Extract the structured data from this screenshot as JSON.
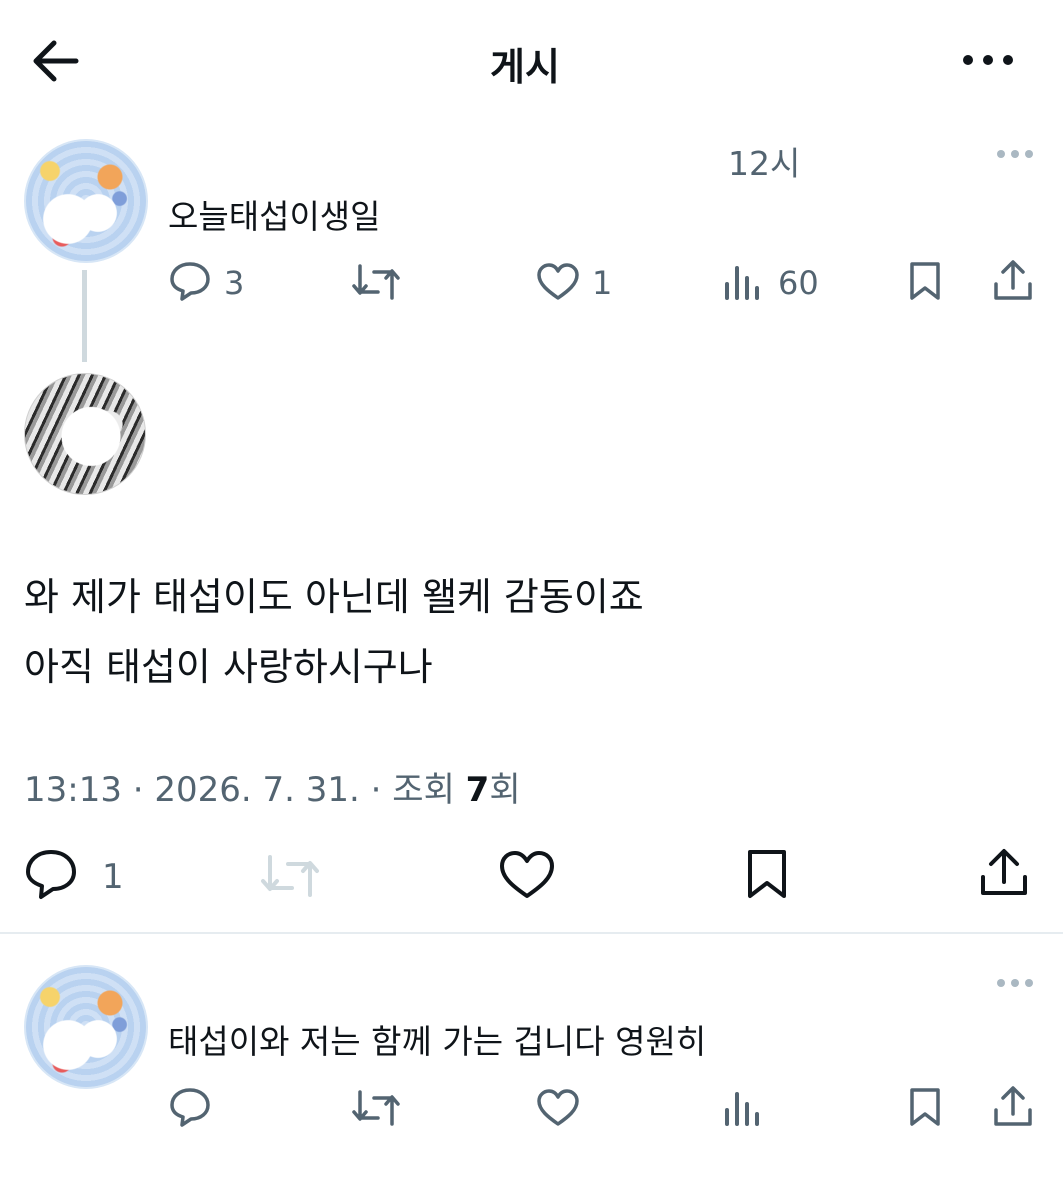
{
  "header": {
    "title": "게시"
  },
  "parent_post": {
    "time": "12시",
    "text": "오늘태섭이생일",
    "replies": "3",
    "likes": "1",
    "views": "60"
  },
  "main_post": {
    "line1": "와 제가 태섭이도 아닌데 왤케 감동이죠",
    "line2": "아직 태섭이 사랑하시구나",
    "meta_prefix": "13:13 · 2026. 7. 31. · 조회 ",
    "meta_views": "7",
    "meta_suffix": "회",
    "replies": "1"
  },
  "reply_post": {
    "text": "태섭이와 저는 함께 가는 겁니다 영원히"
  },
  "colors": {
    "text": "#0f1419",
    "secondary": "#536471",
    "divider": "#e6ecf0"
  }
}
